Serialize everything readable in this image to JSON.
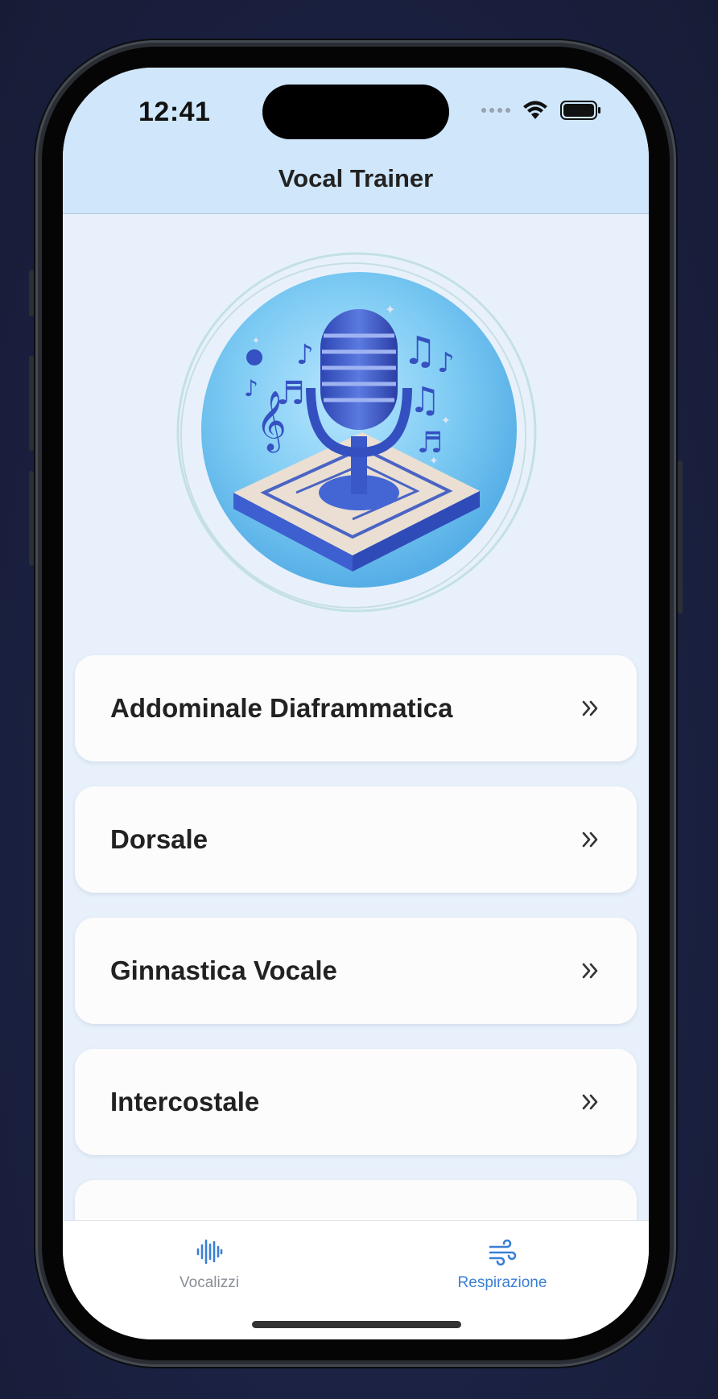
{
  "status_bar": {
    "time": "12:41"
  },
  "header": {
    "title": "Vocal Trainer"
  },
  "logo": {
    "icon": "microphone-with-music-notes-icon"
  },
  "menu": {
    "items": [
      {
        "label": "Addominale Diaframmatica"
      },
      {
        "label": "Dorsale"
      },
      {
        "label": "Ginnastica Vocale"
      },
      {
        "label": "Intercostale"
      },
      {
        "label": ""
      }
    ],
    "chevron_icon": "double-chevron-right-icon"
  },
  "tabbar": {
    "tabs": [
      {
        "label": "Vocalizzi",
        "icon": "waveform-icon",
        "active": false
      },
      {
        "label": "Respirazione",
        "icon": "wind-icon",
        "active": true
      }
    ]
  },
  "colors": {
    "header_bg": "#cfe6fb",
    "content_bg": "#e8f1fb",
    "accent": "#3a7fd5",
    "inactive_tab": "#8a8f96"
  }
}
